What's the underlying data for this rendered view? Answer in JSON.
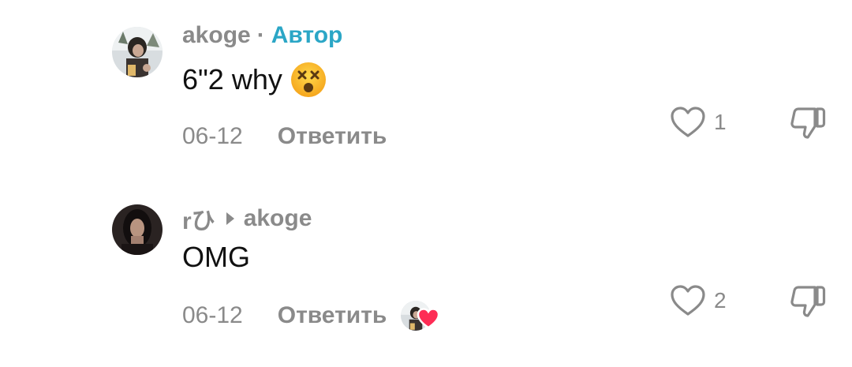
{
  "comments": [
    {
      "username": "akoge",
      "separator": "·",
      "author_tag": "Автор",
      "text": "6\"2 why",
      "emoji_icon": "dizzy-face-emoji",
      "date": "06-12",
      "reply_label": "Ответить",
      "likes": "1"
    },
    {
      "username": "rひ",
      "reply_to": "akoge",
      "text": "OMG",
      "date": "06-12",
      "reply_label": "Ответить",
      "likes": "2",
      "liked_by_creator": true
    }
  ],
  "colors": {
    "meta_gray": "#8a8a8a",
    "author_accent": "#2ba6c6",
    "text": "#111111",
    "heart_badge": "#fe2c55"
  }
}
